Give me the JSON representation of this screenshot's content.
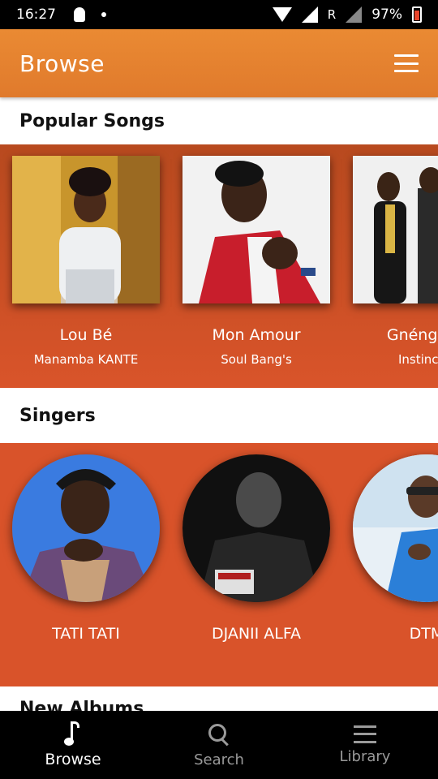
{
  "status_bar": {
    "time": "16:27",
    "network_letter": "R",
    "battery": "97%"
  },
  "app_bar": {
    "title": "Browse"
  },
  "sections": {
    "popular_songs": "Popular Songs",
    "singers": "Singers",
    "new_albums": "New Albums"
  },
  "songs": [
    {
      "title": "Lou Bé",
      "artist": "Manamba KANTE"
    },
    {
      "title": "Mon Amour",
      "artist": "Soul Bang's"
    },
    {
      "title": "Gnénguan",
      "artist": "Instinct K"
    }
  ],
  "singers": [
    {
      "name": "TATI TATI"
    },
    {
      "name": "DJANII ALFA"
    },
    {
      "name": "DTM"
    }
  ],
  "bottom_nav": [
    {
      "label": "Browse",
      "icon": "music-note-icon",
      "active": true
    },
    {
      "label": "Search",
      "icon": "search-icon",
      "active": false
    },
    {
      "label": "Library",
      "icon": "library-icon",
      "active": false
    }
  ],
  "colors": {
    "accent": "#e8832f",
    "strip": "#d9532a",
    "nav_bg": "#000000"
  }
}
